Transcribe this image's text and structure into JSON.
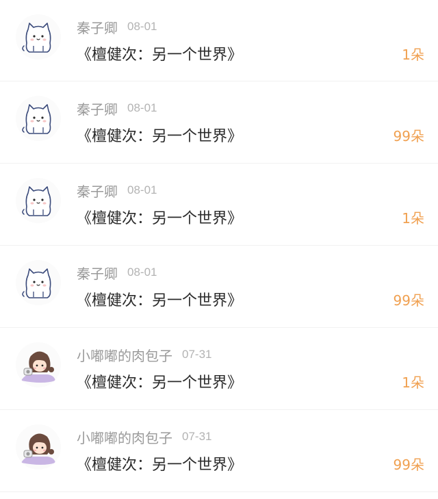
{
  "list": {
    "items": [
      {
        "username": "秦子卿",
        "date": "08-01",
        "title": "《檀健次：另一个世界》",
        "count": "1朵",
        "avatar": "cat-avatar"
      },
      {
        "username": "秦子卿",
        "date": "08-01",
        "title": "《檀健次：另一个世界》",
        "count": "99朵",
        "avatar": "cat-avatar"
      },
      {
        "username": "秦子卿",
        "date": "08-01",
        "title": "《檀健次：另一个世界》",
        "count": "1朵",
        "avatar": "cat-avatar"
      },
      {
        "username": "秦子卿",
        "date": "08-01",
        "title": "《檀健次：另一个世界》",
        "count": "99朵",
        "avatar": "cat-avatar"
      },
      {
        "username": "小嘟嘟的肉包子",
        "date": "07-31",
        "title": "《檀健次：另一个世界》",
        "count": "1朵",
        "avatar": "girl-avatar"
      },
      {
        "username": "小嘟嘟的肉包子",
        "date": "07-31",
        "title": "《檀健次：另一个世界》",
        "count": "99朵",
        "avatar": "girl-avatar"
      }
    ]
  },
  "colors": {
    "username": "#9a9a9a",
    "date": "#b3b3b3",
    "title": "#2b2b2b",
    "count": "#f0a050",
    "divider": "#f1f1f1"
  }
}
